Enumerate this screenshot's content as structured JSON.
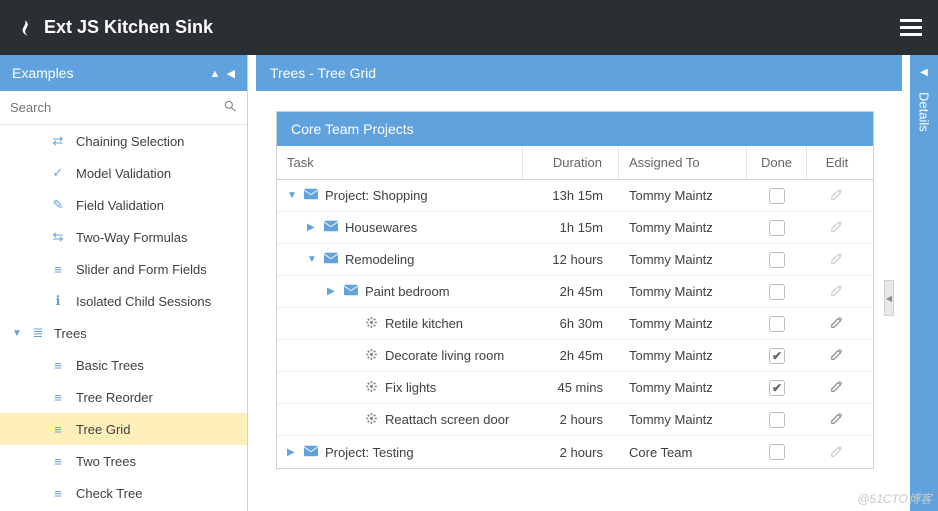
{
  "topbar": {
    "title": "Ext JS Kitchen Sink"
  },
  "sidebar": {
    "title": "Examples",
    "search_placeholder": "Search",
    "items": [
      {
        "icon": "⇄",
        "label": "Chaining Selection"
      },
      {
        "icon": "✓",
        "label": "Model Validation"
      },
      {
        "icon": "✎",
        "label": "Field Validation"
      },
      {
        "icon": "⇆",
        "label": "Two-Way Formulas"
      },
      {
        "icon": "≡",
        "label": "Slider and Form Fields"
      },
      {
        "icon": "ℹ",
        "label": "Isolated Child Sessions"
      }
    ],
    "group": {
      "label": "Trees",
      "icon": "≣"
    },
    "group_items": [
      {
        "icon": "≡",
        "label": "Basic Trees"
      },
      {
        "icon": "≡",
        "label": "Tree Reorder"
      },
      {
        "icon": "≡",
        "label": "Tree Grid",
        "selected": true
      },
      {
        "icon": "≡",
        "label": "Two Trees"
      },
      {
        "icon": "≡",
        "label": "Check Tree"
      }
    ]
  },
  "center": {
    "title": "Trees - Tree Grid",
    "grid_title": "Core Team Projects",
    "columns": {
      "task": "Task",
      "duration": "Duration",
      "assigned": "Assigned To",
      "done": "Done",
      "edit": "Edit"
    },
    "rows": [
      {
        "depth": 0,
        "arrow": "▼",
        "icon": "envelope",
        "task": "Project: Shopping",
        "duration": "13h 15m",
        "assigned": "Tommy Maintz",
        "done": false,
        "editActive": false
      },
      {
        "depth": 1,
        "arrow": "▶",
        "icon": "envelope",
        "task": "Housewares",
        "duration": "1h 15m",
        "assigned": "Tommy Maintz",
        "done": false,
        "editActive": false
      },
      {
        "depth": 1,
        "arrow": "▼",
        "icon": "envelope",
        "task": "Remodeling",
        "duration": "12 hours",
        "assigned": "Tommy Maintz",
        "done": false,
        "editActive": false
      },
      {
        "depth": 2,
        "arrow": "▶",
        "icon": "envelope",
        "task": "Paint bedroom",
        "duration": "2h 45m",
        "assigned": "Tommy Maintz",
        "done": false,
        "editActive": false
      },
      {
        "depth": 3,
        "arrow": "",
        "icon": "gear",
        "task": "Retile kitchen",
        "duration": "6h 30m",
        "assigned": "Tommy Maintz",
        "done": false,
        "editActive": true
      },
      {
        "depth": 3,
        "arrow": "",
        "icon": "gear",
        "task": "Decorate living room",
        "duration": "2h 45m",
        "assigned": "Tommy Maintz",
        "done": true,
        "editActive": true
      },
      {
        "depth": 3,
        "arrow": "",
        "icon": "gear",
        "task": "Fix lights",
        "duration": "45 mins",
        "assigned": "Tommy Maintz",
        "done": true,
        "editActive": true
      },
      {
        "depth": 3,
        "arrow": "",
        "icon": "gear",
        "task": "Reattach screen door",
        "duration": "2 hours",
        "assigned": "Tommy Maintz",
        "done": false,
        "editActive": true
      },
      {
        "depth": 0,
        "arrow": "▶",
        "icon": "envelope",
        "task": "Project: Testing",
        "duration": "2 hours",
        "assigned": "Core Team",
        "done": false,
        "editActive": false
      }
    ]
  },
  "details": {
    "label": "Details"
  },
  "watermark": "@51CTO博客"
}
